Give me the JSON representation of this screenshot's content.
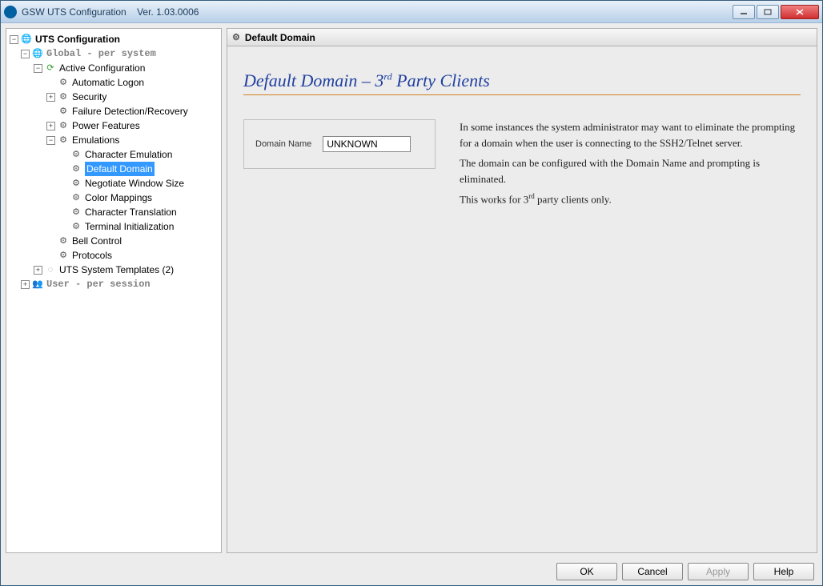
{
  "titlebar": {
    "app_name": "GSW UTS Configuration",
    "version": "Ver. 1.03.0006"
  },
  "tree": {
    "root": "UTS Configuration",
    "global": "Global  - per system",
    "active_config": "Active Configuration",
    "automatic_logon": "Automatic Logon",
    "security": "Security",
    "failure_detection": "Failure Detection/Recovery",
    "power_features": "Power Features",
    "emulations": "Emulations",
    "character_emulation": "Character Emulation",
    "default_domain": "Default Domain",
    "negotiate_window_size": "Negotiate Window Size",
    "color_mappings": "Color Mappings",
    "character_translation": "Character Translation",
    "terminal_initialization": "Terminal Initialization",
    "bell_control": "Bell Control",
    "protocols": "Protocols",
    "uts_system_templates": "UTS System Templates (2)",
    "user": "User   - per session"
  },
  "panel": {
    "header": "Default Domain",
    "title_html": "Default Domain – 3<sup>rd</sup> Party Clients",
    "domain_label": "Domain Name",
    "domain_value": "UNKNOWN",
    "desc1": "In some instances the system administrator may want to eliminate the prompting for a domain when the user is connecting to the SSH2/Telnet server.",
    "desc2": "The domain can be configured with the Domain Name and prompting is eliminated.",
    "desc3_html": "This works for 3<sup>rd</sup> party clients only."
  },
  "buttons": {
    "ok": "OK",
    "cancel": "Cancel",
    "apply": "Apply",
    "help": "Help"
  }
}
